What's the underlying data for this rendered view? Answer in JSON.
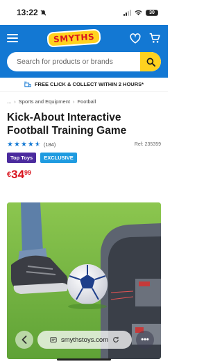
{
  "status": {
    "time": "13:22",
    "battery": "30"
  },
  "header": {
    "logo": "SMYTHS",
    "search_placeholder": "Search for products or brands"
  },
  "promo": {
    "text": "FREE CLICK & COLLECT WITHIN 2 HOURS*"
  },
  "breadcrumb": {
    "ellipsis": "...",
    "items": [
      "Sports and Equipment",
      "Football"
    ]
  },
  "product": {
    "title": "Kick-About Interactive Football Training Game",
    "rating_count": "(184)",
    "rating_stars": 4.5,
    "ref": "Ref: 235359",
    "badges": [
      "Top Toys",
      "EXCLUSIVE"
    ],
    "price": {
      "currency": "€",
      "whole": "34",
      "cents": "99"
    }
  },
  "browser": {
    "url": "smythstoys.com"
  },
  "colors": {
    "brand_blue": "#1378d3",
    "brand_yellow": "#ffd21f",
    "price_red": "#d9151f",
    "badge_purple": "#4b2b9e",
    "badge_blue": "#1f9be0"
  }
}
